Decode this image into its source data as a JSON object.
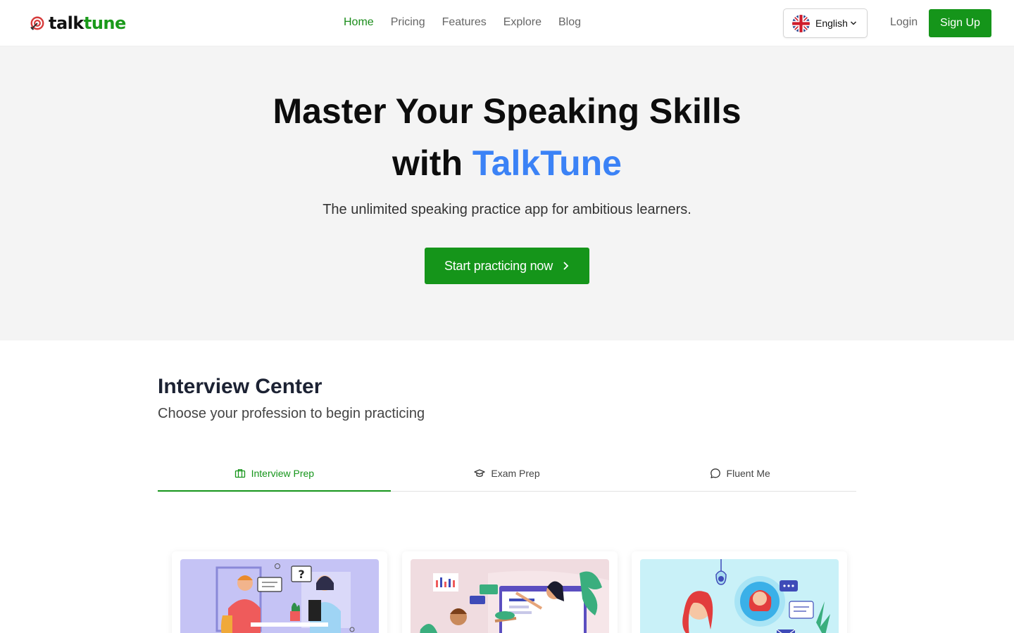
{
  "brand": {
    "logo_part1": "talk",
    "logo_part2": "tune",
    "accent": "#15951a"
  },
  "nav": {
    "links": [
      {
        "label": "Home",
        "active": true
      },
      {
        "label": "Pricing"
      },
      {
        "label": "Features"
      },
      {
        "label": "Explore"
      },
      {
        "label": "Blog"
      }
    ],
    "language": {
      "label": "English",
      "icon": "uk-flag-icon"
    },
    "login": "Login",
    "signup": "Sign Up"
  },
  "hero": {
    "title_line1": "Master Your Speaking Skills",
    "title_with": "with",
    "title_brand": "TalkTune",
    "subtitle": "The unlimited speaking practice app for ambitious learners.",
    "cta": "Start practicing now",
    "brand_color": "#3b82f6"
  },
  "interview_center": {
    "title": "Interview Center",
    "subtitle": "Choose your profession to begin practicing",
    "tabs": [
      {
        "label": "Interview Prep",
        "icon": "briefcase-icon",
        "active": true
      },
      {
        "label": "Exam Prep",
        "icon": "graduation-cap-icon"
      },
      {
        "label": "Fluent Me",
        "icon": "chat-bubble-icon"
      }
    ],
    "cards": [
      {
        "illustration": "interview-meeting-illustration",
        "bg": "#c5c3f5"
      },
      {
        "illustration": "classroom-presentation-illustration",
        "bg": "#f0dce0"
      },
      {
        "illustration": "customer-support-illustration",
        "bg": "#c9f1f8"
      }
    ]
  }
}
